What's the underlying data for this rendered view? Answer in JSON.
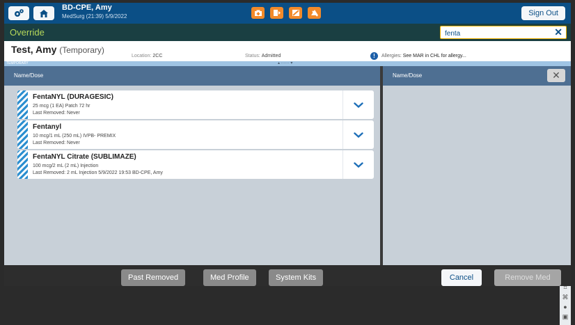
{
  "topbar": {
    "user_name": "BD-CPE, Amy",
    "user_sub": "MedSurg (21:39) 5/9/2022",
    "sign_out": "Sign Out",
    "colors": {
      "bar": "#0b4f86",
      "icon_orange": "#f28a2a"
    },
    "icons": [
      "settings-icon",
      "home-icon",
      "med-icon",
      "return-icon",
      "waste-icon",
      "discrepancy-icon"
    ]
  },
  "override": {
    "title": "Override",
    "search_value": "fenta",
    "clear_glyph": "✕"
  },
  "patient": {
    "name": "Test, Amy",
    "temp_tag": "(Temporary)",
    "location_label": "Location:",
    "location_value": "2CC",
    "status_label": "Status:",
    "status_value": "Admitted",
    "allergies_label": "Allergies:",
    "allergies_value": "See MAR in CHL for allergy...",
    "temporary_strip": "TEMPORARY",
    "expand_glyph": "▴ ······ ▾"
  },
  "left_panel": {
    "header": "Name/Dose",
    "meds": [
      {
        "name": "FentaNYL (DURAGESIC)",
        "dose": "25 mcg (1 EA) Patch 72 hr",
        "removed": "Last Removed: Never"
      },
      {
        "name": "Fentanyl",
        "dose": "10 mcg/1 mL (250 mL) IVPB- PREMIX",
        "removed": "Last Removed: Never"
      },
      {
        "name": "FentaNYL Citrate (SUBLIMAZE)",
        "dose": "100 mcg/2 mL (2 mL) Injection",
        "removed": "Last Removed: 2 mL Injection 5/9/2022 19:53 BD-CPE, Amy"
      }
    ]
  },
  "right_panel": {
    "header": "Name/Dose",
    "close_glyph": "✕"
  },
  "bottom": {
    "past_removed": "Past Removed",
    "med_profile": "Med Profile",
    "system_kits": "System Kits",
    "cancel": "Cancel",
    "remove_med": "Remove Med"
  }
}
